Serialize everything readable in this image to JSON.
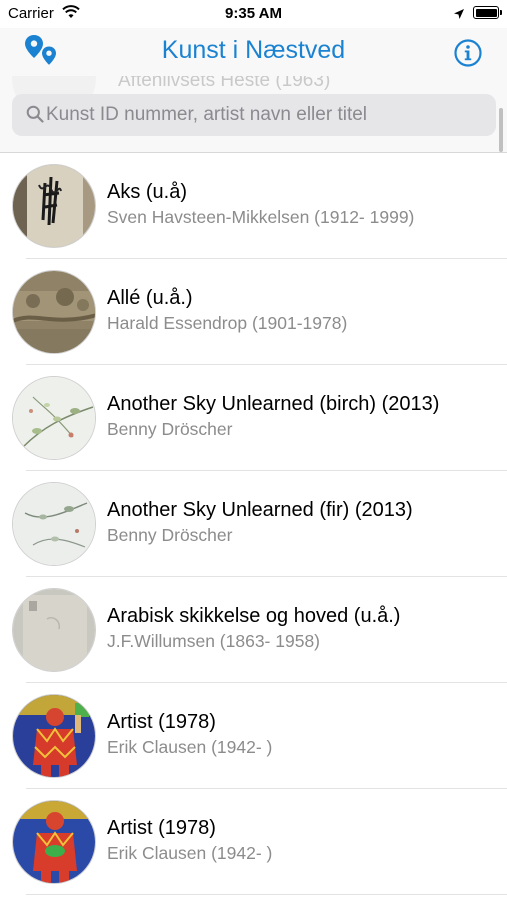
{
  "status_bar": {
    "carrier": "Carrier",
    "time": "9:35 AM"
  },
  "nav": {
    "title": "Kunst i Næstved",
    "left_icon": "map-pins-icon",
    "right_icon": "info-circle-icon",
    "accent_color": "#1b82d1"
  },
  "search": {
    "placeholder": "Kunst ID nummer, artist navn eller titel",
    "value": "",
    "ghost_text": "Aftenlivsets Heste (1963)"
  },
  "artworks": [
    {
      "title": "Aks (u.å)",
      "artist": "Sven Havsteen-Mikkelsen (1912- 1999)",
      "thumb": "aks"
    },
    {
      "title": "Allé (u.å.)",
      "artist": "Harald Essendrop (1901-1978)",
      "thumb": "alle"
    },
    {
      "title": "Another Sky Unlearned (birch) (2013)",
      "artist": "Benny Dröscher",
      "thumb": "birch"
    },
    {
      "title": "Another Sky Unlearned (fir) (2013)",
      "artist": "Benny Dröscher",
      "thumb": "fir"
    },
    {
      "title": "Arabisk skikkelse og hoved (u.å.)",
      "artist": "J.F.Willumsen (1863- 1958)",
      "thumb": "arabisk"
    },
    {
      "title": "Artist (1978)",
      "artist": "Erik Clausen (1942- )",
      "thumb": "artist1"
    },
    {
      "title": "Artist (1978)",
      "artist": "Erik Clausen (1942- )",
      "thumb": "artist2"
    }
  ]
}
